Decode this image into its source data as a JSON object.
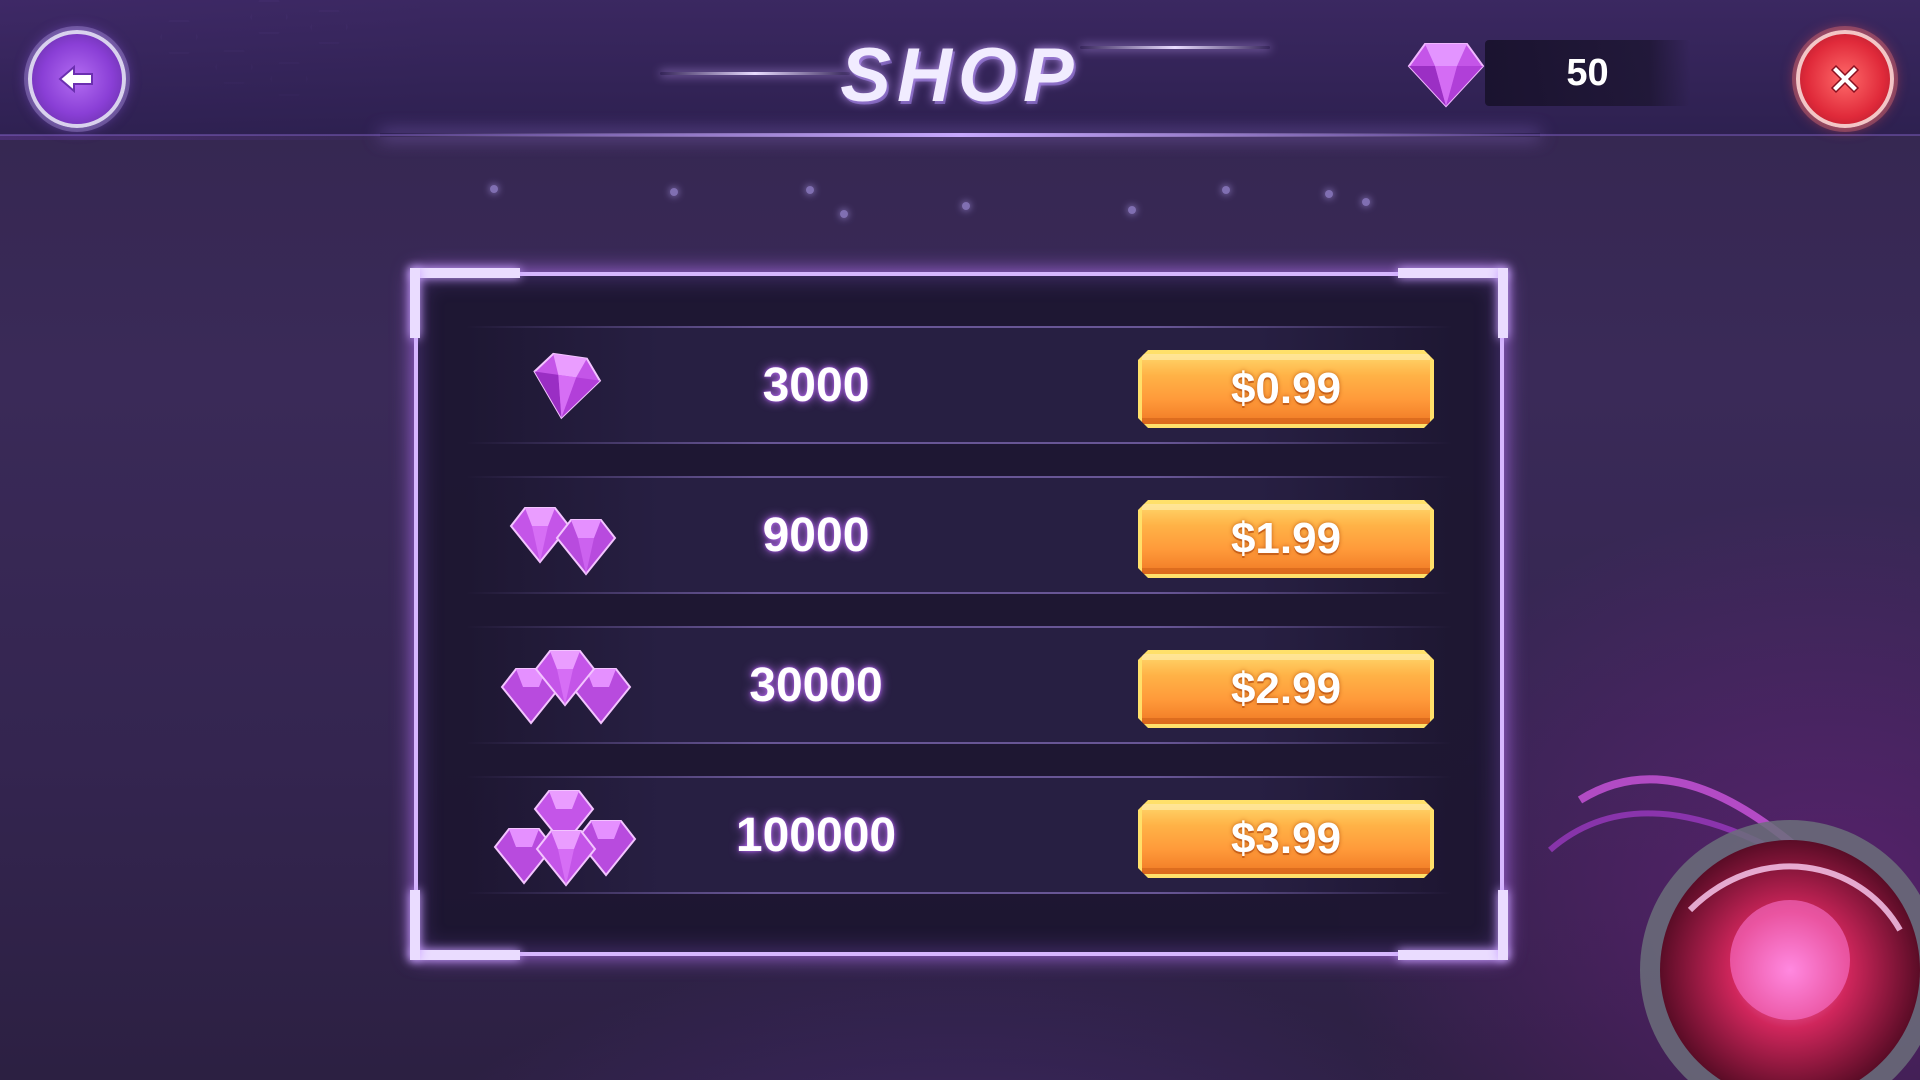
{
  "header": {
    "title": "SHOP",
    "currency_value": "50"
  },
  "shop": {
    "items": [
      {
        "amount": "3000",
        "price": "$0.99",
        "gem_count": 1
      },
      {
        "amount": "9000",
        "price": "$1.99",
        "gem_count": 2
      },
      {
        "amount": "30000",
        "price": "$2.99",
        "gem_count": 3
      },
      {
        "amount": "100000",
        "price": "$3.99",
        "gem_count": 4
      }
    ]
  },
  "colors": {
    "gem": "#c455e8",
    "price_button": "#ffa53f",
    "panel_border": "#d7b7ff",
    "close_button": "#e02a3a",
    "back_button": "#8a3fd6"
  },
  "icons": {
    "back": "back-arrow-icon",
    "close": "close-x-icon",
    "currency": "gem-icon"
  }
}
